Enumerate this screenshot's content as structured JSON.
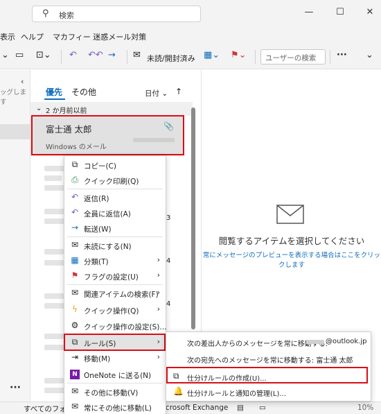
{
  "search": {
    "placeholder": "検索"
  },
  "menubar": {
    "items": [
      "表示",
      "ヘルプ",
      "マカフィー 迷惑メール対策"
    ]
  },
  "ribbon": {
    "read_unread": "未読/開封済み",
    "user_search_placeholder": "ユーザーの検索",
    "more": "···"
  },
  "folder_pane": {
    "truncated_text": "ッグします"
  },
  "message_list": {
    "tabs": [
      "優先",
      "その他"
    ],
    "sort_label": "日付",
    "sort_direction": "↑",
    "group_header": "2 か月前以前",
    "selected_message": {
      "from": "富士通 太郎",
      "subject": "Windows のメール"
    },
    "row_numbers": [
      "3",
      "4",
      "4"
    ]
  },
  "reading_pane": {
    "title": "閲覧するアイテムを選択してください",
    "link": "常にメッセージのプレビューを表示する場合はここをクリックします"
  },
  "status_bar": {
    "left": "すべてのフォル",
    "middle": "icrosoft Exchange",
    "zoom": "10%"
  },
  "context_menu": {
    "items": [
      {
        "label": "コピー(C)",
        "icon": "copy-icon"
      },
      {
        "label": "クイック印刷(Q)",
        "icon": "print-icon"
      },
      {
        "label": "返信(R)",
        "icon": "reply-icon"
      },
      {
        "label": "全員に返信(A)",
        "icon": "reply-all-icon"
      },
      {
        "label": "転送(W)",
        "icon": "forward-icon"
      },
      {
        "label": "未読にする(N)",
        "icon": "unread-icon"
      },
      {
        "label": "分類(T)",
        "icon": "categorize-icon"
      },
      {
        "label": "フラグの設定(U)",
        "icon": "flag-icon"
      },
      {
        "label": "関連アイテムの検索(F)",
        "icon": "find-related-icon"
      },
      {
        "label": "クイック操作(Q)",
        "icon": "quick-steps-icon"
      },
      {
        "label": "クイック操作の設定(S)...",
        "icon": "settings-icon"
      },
      {
        "label": "ルール(S)",
        "icon": "rules-icon"
      },
      {
        "label": "移動(M)",
        "icon": "move-icon"
      },
      {
        "label": "OneNote に送る(N)",
        "icon": "onenote-icon"
      },
      {
        "label": "その他に移動(V)",
        "icon": "move-other-icon"
      },
      {
        "label": "常にその他に移動(L)",
        "icon": "always-move-other-icon"
      }
    ]
  },
  "rules_submenu": {
    "items": [
      {
        "label": "次の差出人からのメッセージを常に移動する:",
        "suffix": "@outlook.jp"
      },
      {
        "label": "次の宛先へのメッセージを常に移動する: 富士通 太郎"
      },
      {
        "label": "仕分けルールの作成(U)..."
      },
      {
        "label": "仕分けルールと通知の管理(L)..."
      }
    ]
  },
  "colors": {
    "accent": "#0f6cbd",
    "highlight_box": "#d90d16",
    "flag": "#d13438"
  }
}
